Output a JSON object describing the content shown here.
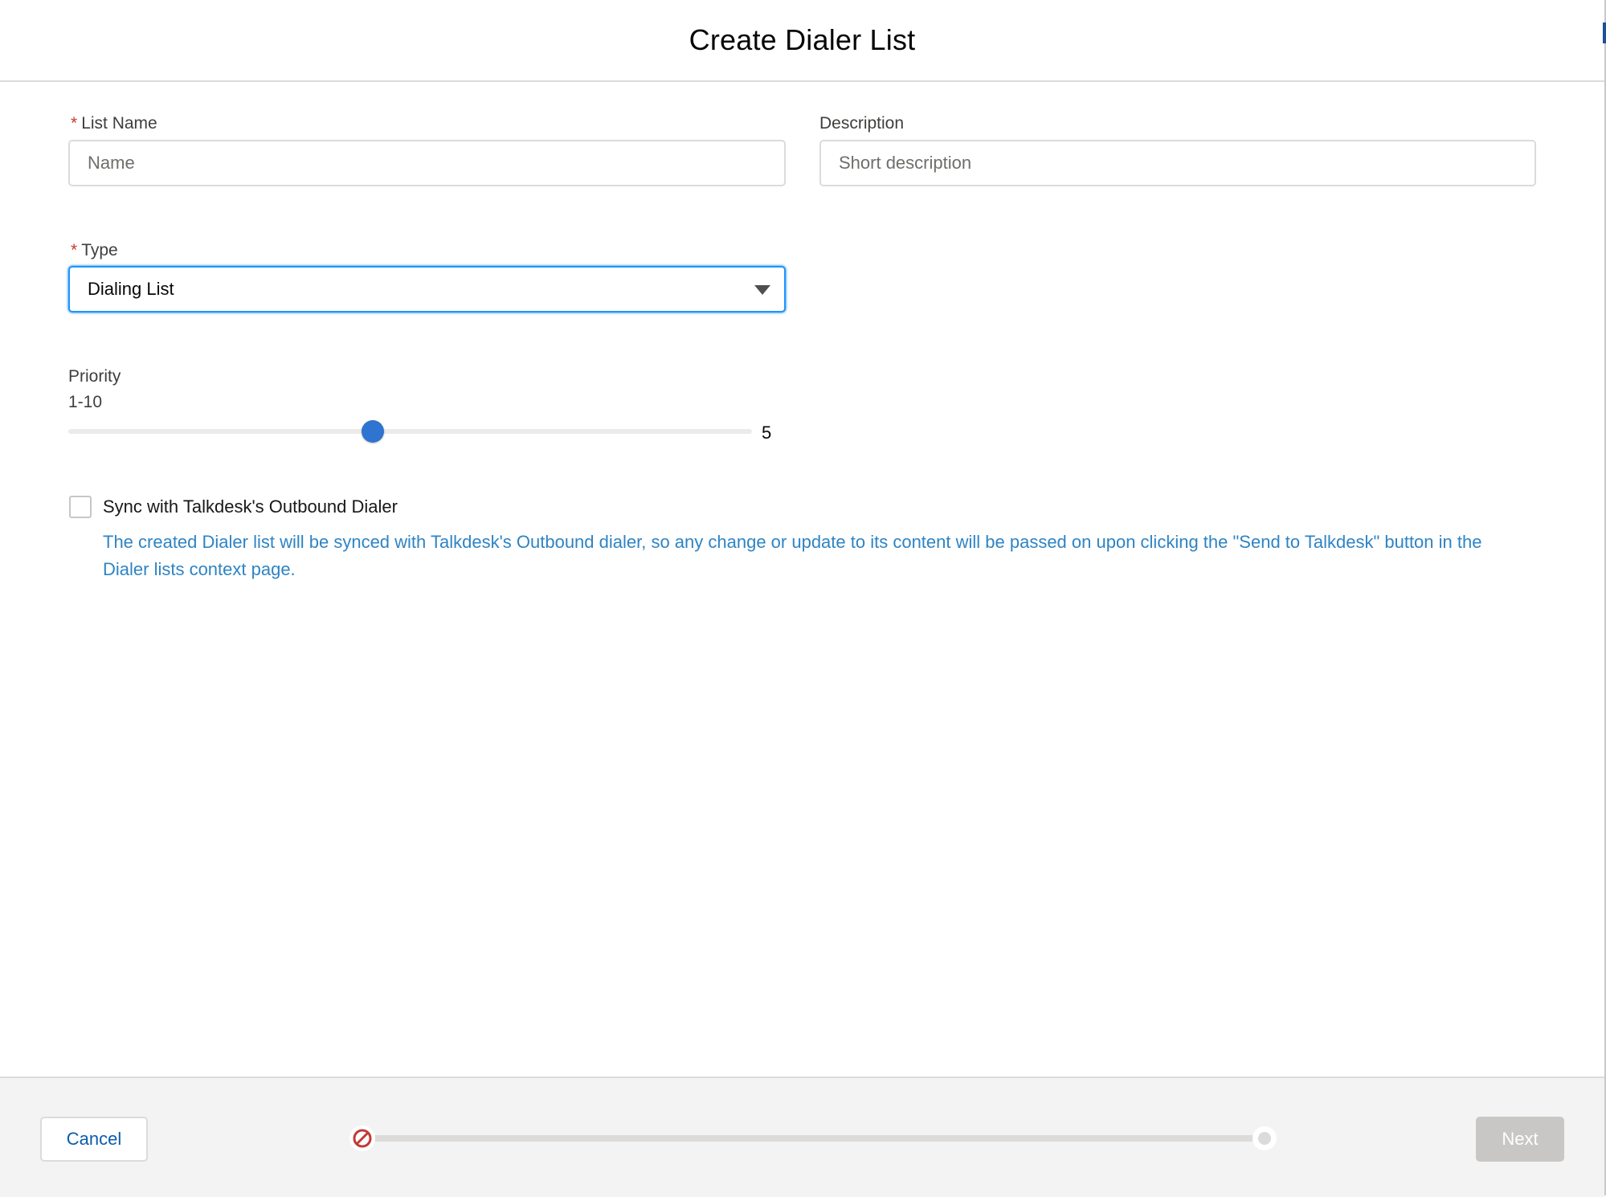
{
  "header": {
    "title": "Create Dialer List"
  },
  "form": {
    "list_name": {
      "required_mark": "*",
      "label": "List Name",
      "value": "",
      "placeholder": "Name"
    },
    "description": {
      "label": "Description",
      "value": "",
      "placeholder": "Short description"
    },
    "type": {
      "required_mark": "*",
      "label": "Type",
      "selected": "Dialing List"
    },
    "priority": {
      "label": "Priority",
      "range_label": "1-10",
      "min": 1,
      "max": 10,
      "value": "5"
    },
    "sync": {
      "checked": false,
      "label": "Sync with Talkdesk's Outbound Dialer",
      "help_text": "The created Dialer list will be synced with Talkdesk's Outbound dialer, so any change or update to its content will be passed on upon clicking the \"Send to Talkdesk\" button in the Dialer lists context page."
    }
  },
  "footer": {
    "cancel_label": "Cancel",
    "next_label": "Next",
    "progress_start_icon": "prohibited-icon",
    "progress_end_icon": "step-circle-icon"
  },
  "colors": {
    "required": "#c23934",
    "focus_border": "#1b96ff",
    "slider_thumb": "#2e74d0",
    "help_text": "#2e84c4",
    "link_button": "#0b5cab",
    "disabled_button": "#c9c7c5",
    "error_icon": "#c23934"
  }
}
